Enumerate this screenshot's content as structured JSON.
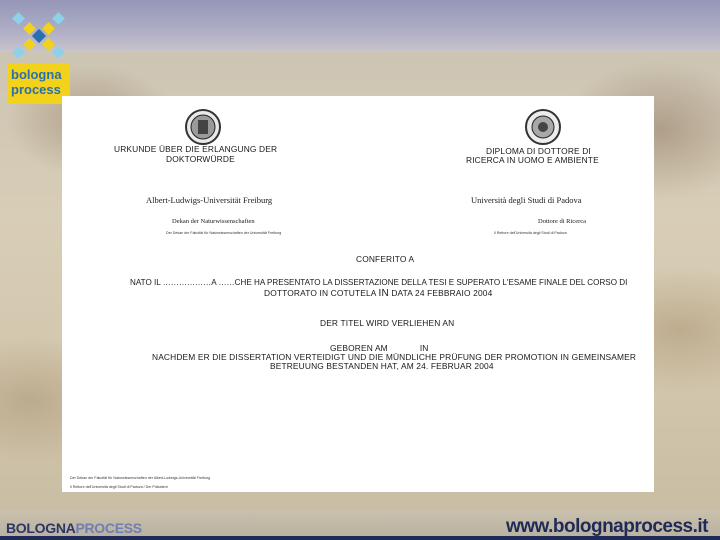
{
  "logo": {
    "line1": "bologna",
    "line2": "process"
  },
  "footer": {
    "left_a": "BOLOGNA",
    "left_b": "PROCESS",
    "right": "www.bolognaprocess.it"
  },
  "doc": {
    "left_title_1": "URKUNDE ÜBER DIE ERLANGUNG DER",
    "left_title_2": "DOKTORWÜRDE",
    "right_title_1": "DIPLOMA DI DOTTORE DI",
    "right_title_2": "RICERCA IN UOMO E AMBIENTE",
    "left_university": "Albert-Ludwigs-Universität Freiburg",
    "right_university": "Università degli Studi di Padova",
    "left_dept": "Dekan der Naturwissenschaften",
    "right_dept": "Dottore di Ricerca",
    "left_tiny": "Der Dekan der Fakultät für Naturwissenschaften der Universität Freiburg",
    "right_tiny": "Il Rettore dell'Università degli Studi di Padova",
    "conferito": "CONFERITO A",
    "nato_line": "NATO IL ………………A ……CHE HA PRESENTATO LA DISSERTAZIONE DELLA TESI E SUPERATO L'ESAME FINALE DEL CORSO DI",
    "dottorato_a": "DOTTORATO IN COTUTELA",
    "dottorato_b": "IN",
    "dottorato_c": "DATA 24 FEBBRAIO 2004",
    "titel": "DER TITEL WIRD VERLIEHEN AN",
    "geboren_a": "GEBOREN AM",
    "geboren_b": "IN",
    "nachdem": "NACHDEM ER DIE DISSERTATION VERTEIDIGT UND DIE MÜNDLICHE PRÜFUNG DER PROMOTION IN GEMEINSAMER",
    "betreuung_a": "BETREUUNG BESTANDEN HAT,",
    "betreuung_b": "AM 24. FEBRUAR 2004",
    "bottom_tiny_1": "Der Dekan der Fakultät für Naturwissenschaften der Albert-Ludwigs-Universität Freiburg",
    "bottom_tiny_2": "Il Rettore dell'Università degli Studi di Padova / Der Präsident"
  },
  "colors": {
    "navy": "#1f2a57",
    "logo_yellow": "#f2d21a",
    "logo_blue": "#2a6fb0"
  }
}
